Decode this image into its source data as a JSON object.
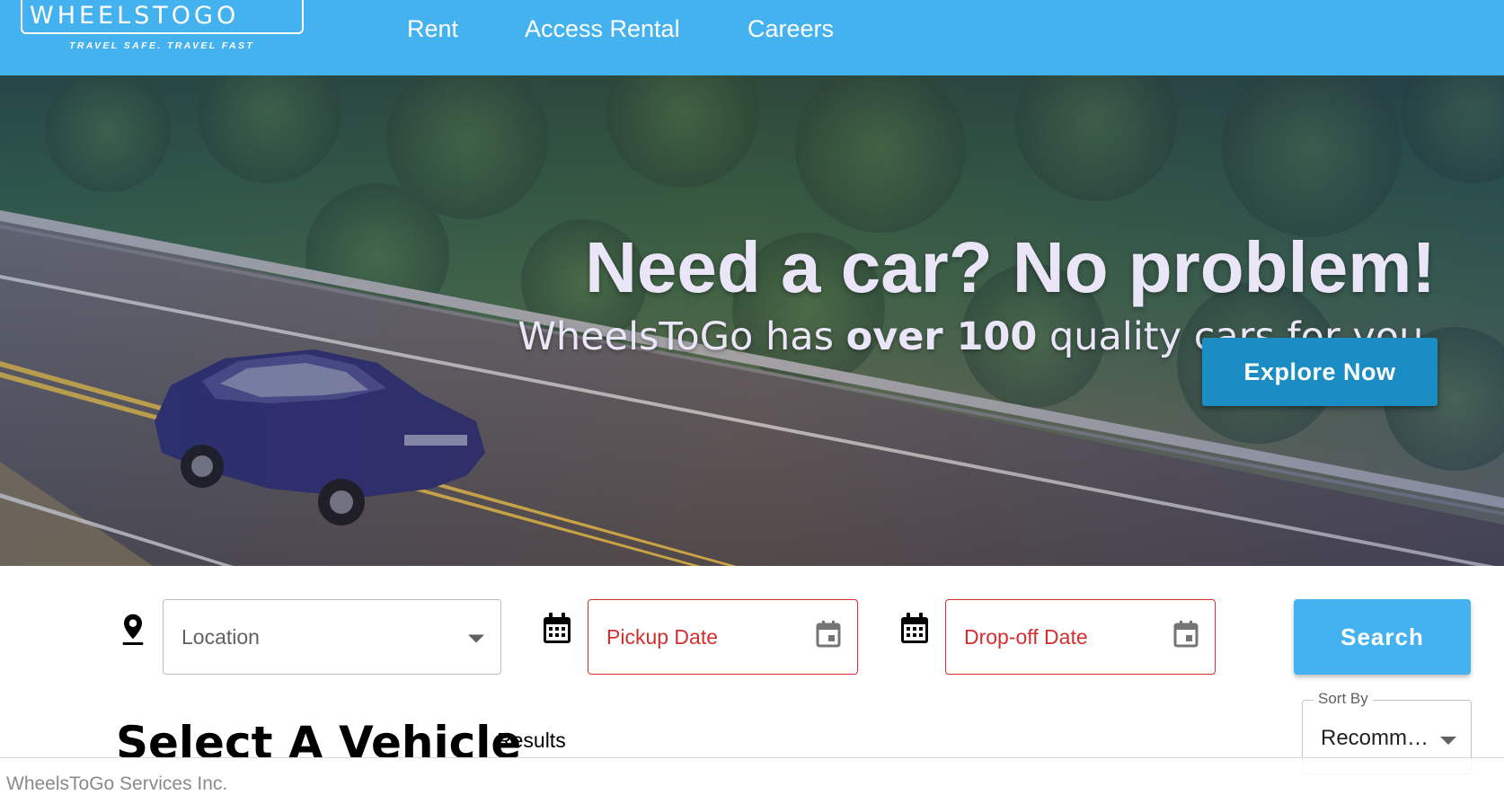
{
  "brand": {
    "name": "WHEELSTOGO",
    "tagline": "TRAVEL SAFE. TRAVEL FAST"
  },
  "nav": {
    "items": [
      {
        "label": "Rent"
      },
      {
        "label": "Access Rental"
      },
      {
        "label": "Careers"
      }
    ]
  },
  "hero": {
    "title": "Need a car? No problem!",
    "subtitle_pre": "WheelsToGo has ",
    "subtitle_bold": "over 100",
    "subtitle_post": " quality cars for you.",
    "cta_label": "Explore Now"
  },
  "search": {
    "location_placeholder": "Location",
    "pickup_placeholder": "Pickup Date",
    "dropoff_placeholder": "Drop-off Date",
    "button_label": "Search"
  },
  "results": {
    "title": "Select A Vehicle",
    "label": "Results",
    "sort_label": "Sort By",
    "sort_value": "Recommended"
  },
  "footer": {
    "text": "WheelsToGo Services Inc."
  },
  "colors": {
    "nav_bg": "#45b2f0",
    "cta_bg": "#1a8dc5",
    "error_red": "#d32f2f"
  }
}
